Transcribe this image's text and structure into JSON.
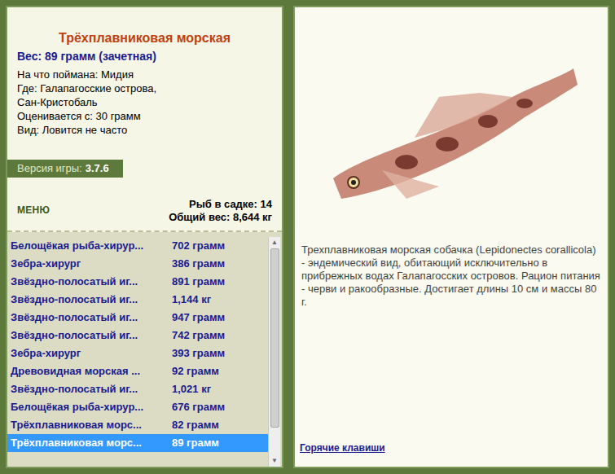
{
  "fish": {
    "title": "Трёхплавниковая морская",
    "weight": "Вес: 89 грамм (зачетная)",
    "details": [
      "На что поймана: Мидия",
      "Где: Галапагосские острова,",
      "Сан-Кристобаль",
      "Оценивается с: 30 грамм",
      "Вид: Ловится не часто"
    ]
  },
  "version": {
    "label": "Версия игры:",
    "value": "3.7.6"
  },
  "menu": "МЕНЮ",
  "keepnet": {
    "count": "Рыб в садке: 14",
    "total": "Общий вес: 8,644 кг"
  },
  "catch_list": [
    {
      "name": "Белощёкая рыба-хирур...",
      "weight": "702 грамм",
      "selected": false
    },
    {
      "name": "Зебра-хирург",
      "weight": "386 грамм",
      "selected": false
    },
    {
      "name": "Звёздно-полосатый иг...",
      "weight": "891 грамм",
      "selected": false
    },
    {
      "name": "Звёздно-полосатый иг...",
      "weight": "1,144 кг",
      "selected": false
    },
    {
      "name": "Звёздно-полосатый иг...",
      "weight": "947 грамм",
      "selected": false
    },
    {
      "name": "Звёздно-полосатый иг...",
      "weight": "742 грамм",
      "selected": false
    },
    {
      "name": "Зебра-хирург",
      "weight": "393 грамм",
      "selected": false
    },
    {
      "name": "Древовидная морская ...",
      "weight": "92 грамм",
      "selected": false
    },
    {
      "name": "Звёздно-полосатый иг...",
      "weight": "1,021 кг",
      "selected": false
    },
    {
      "name": "Белощёкая рыба-хирур...",
      "weight": "676 грамм",
      "selected": false
    },
    {
      "name": "Трёхплавниковая морс...",
      "weight": "82 грамм",
      "selected": false
    },
    {
      "name": "Трёхплавниковая морс...",
      "weight": "89 грамм",
      "selected": true
    }
  ],
  "description": "Трехплавниковая морская собачка (Lepidonectes corallicola) - эндемический вид, обитающий исключительно в прибрежных водах Галапагосских островов. Рацион питания - черви и ракообразные. Достигает длины 10 см и массы 80 г.",
  "hotkeys": "Горячие клавиши"
}
